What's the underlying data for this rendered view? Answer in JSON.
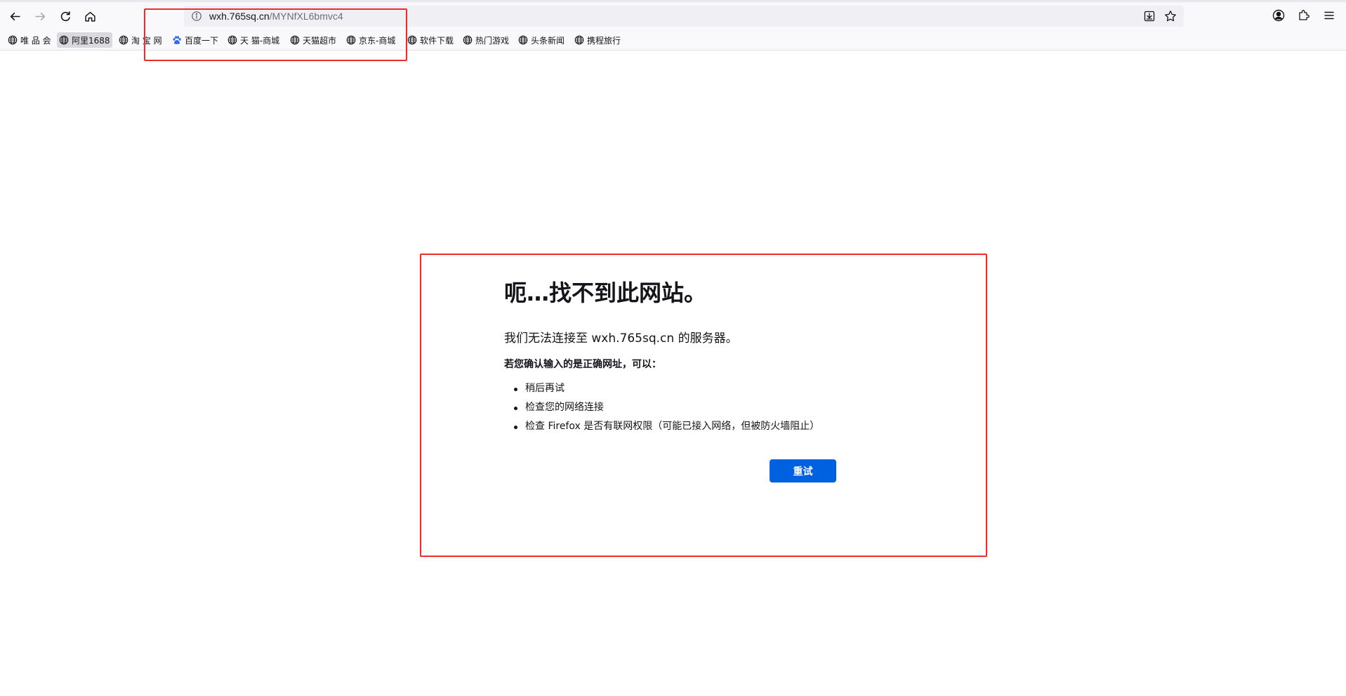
{
  "browser": {
    "url_host": "wxh.765sq.cn",
    "url_path": "/MYNfXL6bmvc4",
    "icons": {
      "back": "back-arrow-icon",
      "forward": "forward-arrow-icon",
      "reload": "reload-icon",
      "home": "home-icon",
      "site_info": "info-icon",
      "download": "download-icon",
      "bookmark_star": "star-icon",
      "account": "account-icon",
      "extensions": "puzzle-icon",
      "menu": "hamburger-menu-icon"
    }
  },
  "bookmarks": [
    {
      "label": "唯 品 会",
      "icon": "globe-icon"
    },
    {
      "label": "阿里1688",
      "icon": "globe-icon"
    },
    {
      "label": "淘 宝 网",
      "icon": "globe-icon"
    },
    {
      "label": "百度一下",
      "icon": "baidu-paw-icon"
    },
    {
      "label": "天 猫-商城",
      "icon": "globe-icon"
    },
    {
      "label": "天猫超市",
      "icon": "globe-icon"
    },
    {
      "label": "京东-商城",
      "icon": "globe-icon"
    },
    {
      "label": "软件下载",
      "icon": "globe-icon"
    },
    {
      "label": "热门游戏",
      "icon": "globe-icon"
    },
    {
      "label": "头条新闻",
      "icon": "globe-icon"
    },
    {
      "label": "携程旅行",
      "icon": "globe-icon"
    }
  ],
  "error": {
    "title": "呃…找不到此网站。",
    "description": "我们无法连接至 wxh.765sq.cn 的服务器。",
    "subheading": "若您确认输入的是正确网址，可以：",
    "suggestions": [
      "稍后再试",
      "检查您的网络连接",
      "检查 Firefox 是否有联网权限（可能已接入网络，但被防火墙阻止）"
    ],
    "retry_label": "重试"
  },
  "colors": {
    "accent": "#0061e0",
    "annotation": "#ef2b2b",
    "toolbar_bg": "#f9f9fb",
    "urlbar_bg": "#f0f0f4"
  }
}
